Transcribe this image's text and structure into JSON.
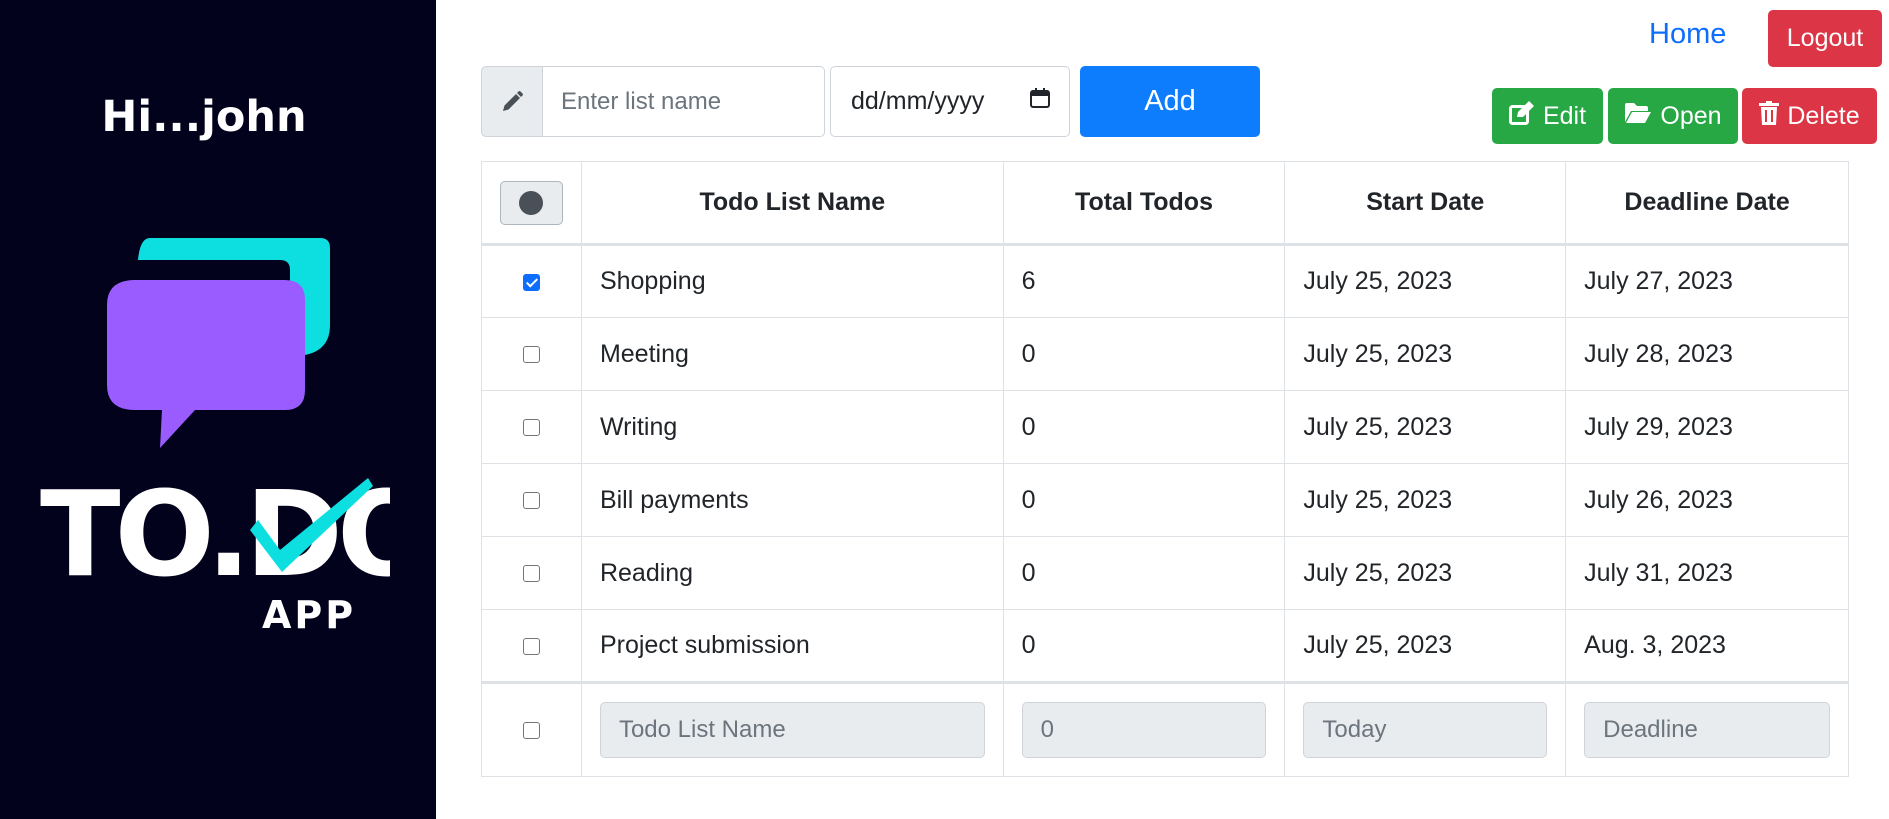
{
  "sidebar": {
    "greeting": "Hi...john",
    "logo_text": "TO.DO",
    "logo_sub": "APP"
  },
  "nav": {
    "home_label": "Home",
    "logout_label": "Logout"
  },
  "add_form": {
    "name_placeholder": "Enter list name",
    "date_placeholder": "dd/mm/yyyy",
    "add_label": "Add"
  },
  "actions": {
    "edit_label": "Edit",
    "open_label": "Open",
    "delete_label": "Delete"
  },
  "table": {
    "headers": [
      "Todo List Name",
      "Total Todos",
      "Start Date",
      "Deadline Date"
    ],
    "rows": [
      {
        "checked": true,
        "name": "Shopping",
        "total": "6",
        "start": "July 25, 2023",
        "deadline": "July 27, 2023"
      },
      {
        "checked": false,
        "name": "Meeting",
        "total": "0",
        "start": "July 25, 2023",
        "deadline": "July 28, 2023"
      },
      {
        "checked": false,
        "name": "Writing",
        "total": "0",
        "start": "July 25, 2023",
        "deadline": "July 29, 2023"
      },
      {
        "checked": false,
        "name": "Bill payments",
        "total": "0",
        "start": "July 25, 2023",
        "deadline": "July 26, 2023"
      },
      {
        "checked": false,
        "name": "Reading",
        "total": "0",
        "start": "July 25, 2023",
        "deadline": "July 31, 2023"
      },
      {
        "checked": false,
        "name": "Project submission",
        "total": "0",
        "start": "July 25, 2023",
        "deadline": "Aug. 3, 2023"
      }
    ],
    "footer": {
      "name_placeholder": "Todo List Name",
      "total_placeholder": "0",
      "start_placeholder": "Today",
      "deadline_placeholder": "Deadline"
    }
  },
  "colors": {
    "sidebar_bg": "#03021c",
    "primary": "#0d7cfd",
    "success": "#28a745",
    "danger": "#dc3545",
    "logo_cyan": "#0ddfe0",
    "logo_purple": "#9b5cff"
  }
}
